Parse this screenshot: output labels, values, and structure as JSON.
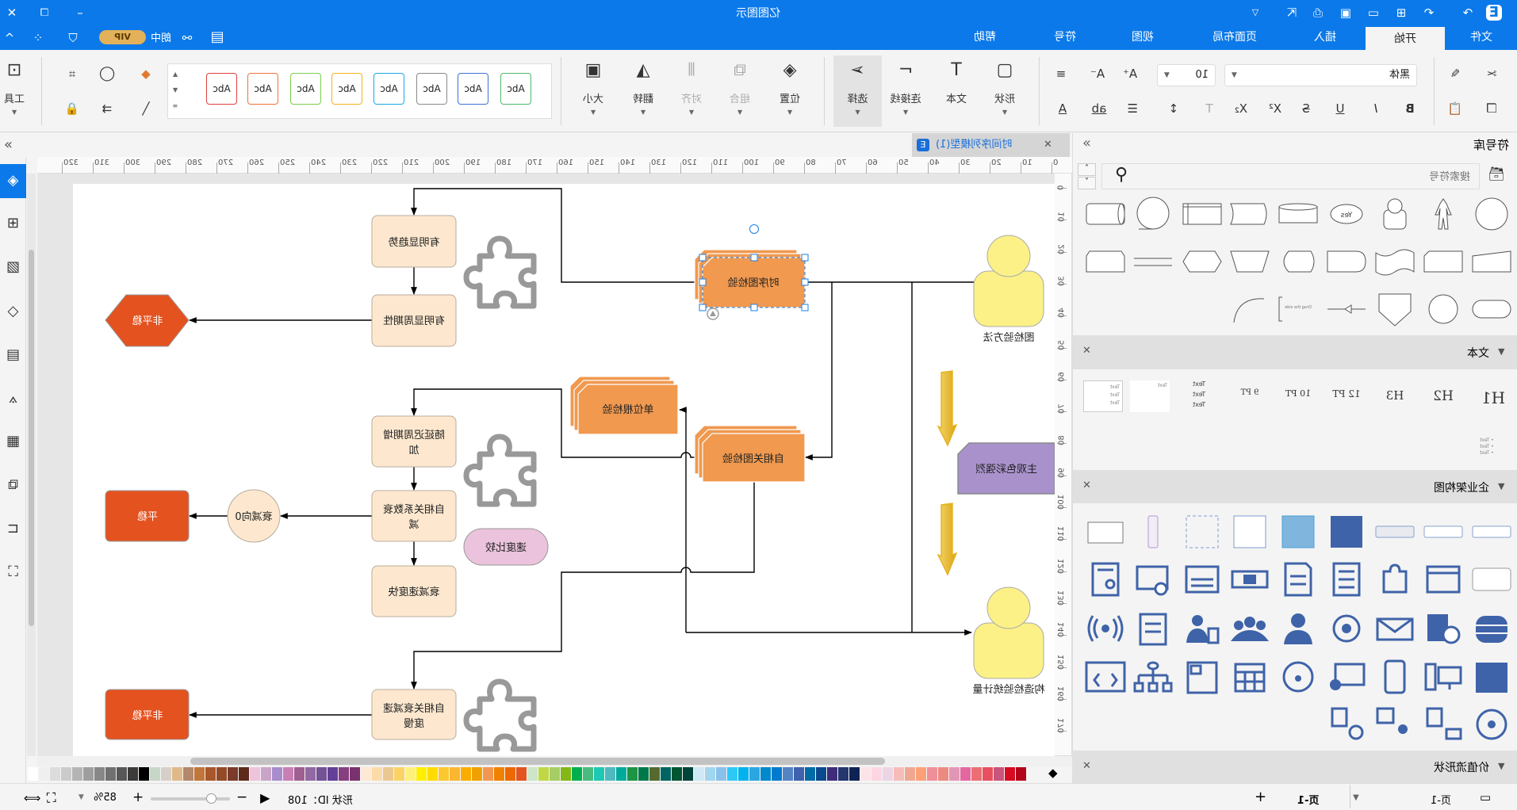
{
  "app": {
    "title": "亿图图示",
    "accent": "#0b79e9"
  },
  "titlebar": {
    "icons": [
      "app-logo-icon",
      "redo-icon",
      "undo-icon",
      "new-file-icon",
      "open-folder-icon",
      "save-icon",
      "print-icon",
      "export-icon",
      "customize-icon",
      "minimize-icon",
      "restore-icon",
      "close-icon"
    ]
  },
  "tabs": [
    {
      "label": "文件"
    },
    {
      "label": "开始",
      "active": true
    },
    {
      "label": "插入"
    },
    {
      "label": "页面布局"
    },
    {
      "label": "视图"
    },
    {
      "label": "符号"
    },
    {
      "label": "帮助"
    }
  ],
  "account": {
    "vip": "VIP",
    "user": "朗中"
  },
  "ribbon": {
    "font_name": "黑体",
    "font_size": "10",
    "big_buttons": {
      "shape": "形状",
      "text": "文本",
      "connector": "连接线",
      "select": "选择",
      "position": "位置",
      "group": "组合",
      "align": "对齐",
      "flip": "翻转",
      "size": "大小",
      "tools": "工具"
    },
    "style_gallery": [
      {
        "label": "Abc",
        "color": "#4cb86a"
      },
      {
        "label": "Abc",
        "color": "#3d72d6"
      },
      {
        "label": "Abc",
        "color": "#8a8a8a"
      },
      {
        "label": "Abc",
        "color": "#1ea8e6"
      },
      {
        "label": "Abc",
        "color": "#f2b21c"
      },
      {
        "label": "Abc",
        "color": "#7ccc4c"
      },
      {
        "label": "Abc",
        "color": "#f0723a"
      },
      {
        "label": "Abc",
        "color": "#e04040"
      }
    ]
  },
  "document_tab": {
    "title": "时间序列模型(1)"
  },
  "rulers": {
    "horizontal": [
      0,
      10,
      20,
      30,
      40,
      50,
      60,
      70,
      80,
      90,
      100,
      110,
      120,
      130,
      140,
      150,
      160,
      170,
      180,
      190,
      200,
      210,
      220,
      230,
      240,
      250,
      260,
      270,
      280,
      290,
      300,
      310,
      320
    ],
    "vertical": [
      0,
      10,
      20,
      30,
      40,
      50,
      60,
      70,
      80,
      90,
      100,
      110,
      120,
      130,
      140,
      150,
      160,
      170
    ]
  },
  "diagram": {
    "n1": "有明显趋势",
    "n2": "有明显周期性",
    "n3": "非平稳",
    "n4a": "随延迟周期增",
    "n4b": "加",
    "n5a": "自相关系数衰",
    "n5b": "减",
    "n6": "衰减向0",
    "n7": "平稳",
    "n8": "速度比较",
    "n9": "衰减速度快",
    "n10a": "自相关衰减速",
    "n10b": "度慢",
    "n11": "非平稳",
    "t1": "时序图检验",
    "t2": "单位根检验",
    "t3": "自相关图检验",
    "p1": "图检验方法",
    "p2": "构造检验统计量",
    "s1": "主观色彩强烈"
  },
  "right_panel": {
    "title": "符号库",
    "search_placeholder": "搜索符号",
    "sections": {
      "text": "文本",
      "enterprise": "企业架构图",
      "value_stream": "价值流形状"
    },
    "text_items": [
      "H1",
      "H2",
      "H3",
      "12 PT",
      "10 PT",
      "9 PT"
    ],
    "text_sample": "Text",
    "shape_yes": "Yes"
  },
  "palette": [
    "#ffffff",
    "#efefef",
    "#dcdcdc",
    "#cbcbcb",
    "#b4b4b4",
    "#9e9e9e",
    "#878787",
    "#707070",
    "#575757",
    "#3d3a3a",
    "#000000",
    "#c8d6c8",
    "#d6cfc8",
    "#dfb987",
    "#b3876a",
    "#c0763a",
    "#a9572a",
    "#934a27",
    "#7a3a2c",
    "#5e2a1c",
    "#eec3dc",
    "#c9a3c8",
    "#a98ccc",
    "#c97fb5",
    "#a05f91",
    "#9269a3",
    "#735296",
    "#643f96",
    "#85407f",
    "#7a316e",
    "#fde8d3",
    "#fddba8",
    "#ecc891",
    "#fbd364",
    "#fdf07c",
    "#fff000",
    "#ffdb00",
    "#fbc82f",
    "#fbb72f",
    "#fbac00",
    "#f0a000",
    "#f39650",
    "#f08200",
    "#ec6800",
    "#e35420",
    "#cde6c8",
    "#c0d843",
    "#a6ce64",
    "#84b817",
    "#00b050",
    "#48bb7e",
    "#1ec9b3",
    "#50b9bf",
    "#00ab9c",
    "#1e9444",
    "#00794a",
    "#56692e",
    "#006461",
    "#005532",
    "#00443a",
    "#cfe9f5",
    "#a2d5ee",
    "#8ac1ea",
    "#2ec8f5",
    "#00b2ee",
    "#2ba7e0",
    "#0088cc",
    "#007acc",
    "#5584c3",
    "#3f61ae",
    "#006ca7",
    "#0a4a8f",
    "#3f2d7a",
    "#24376e",
    "#0e2254",
    "#fde3e8",
    "#fdd6e4",
    "#ebd5e5",
    "#f6bcb8",
    "#f0a792",
    "#fca078",
    "#ee8f9a",
    "#ec8a80",
    "#e296b6",
    "#e567a0",
    "#ea6e74",
    "#e8505f",
    "#c9547c",
    "#d80b20",
    "#b3051a"
  ],
  "statusbar": {
    "shape_id": "形状 ID：108",
    "zoom": "85%",
    "zoom_level": 0.85,
    "page_current": "页-1",
    "page_tab": "页-1"
  }
}
